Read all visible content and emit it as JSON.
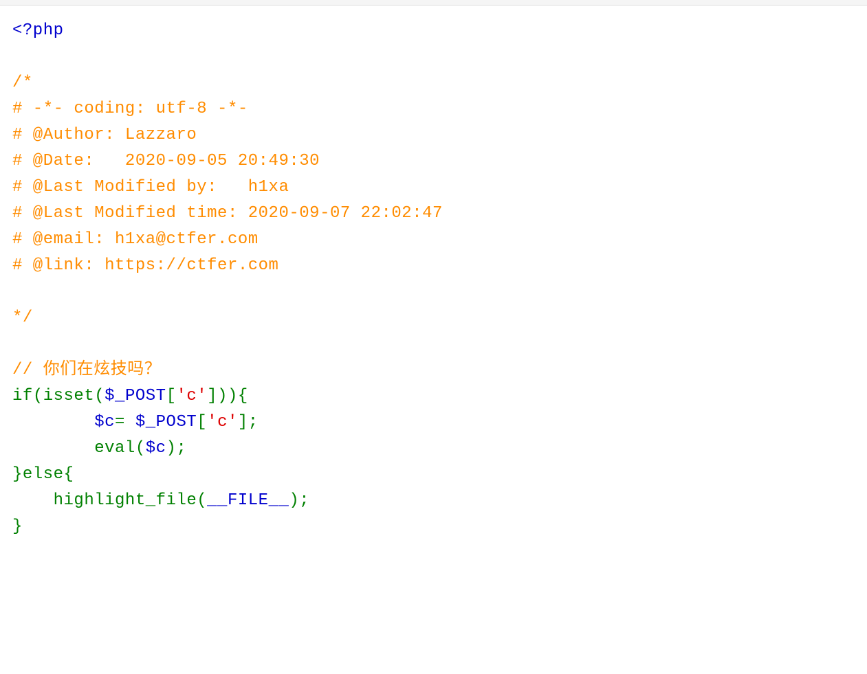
{
  "code": {
    "phpOpen": "<?php",
    "commentBlock": {
      "open": "/*",
      "line1_a": "# -*- coding: utf-8 -*-",
      "line2_a": "# @Author: Lazzaro",
      "line3_a": "# @Date:   2020-09-05 20:49:30",
      "line4_a": "# @Last Modified by:   h1xa",
      "line5_a": "# @Last Modified time: 2020-09-07 22:02:47",
      "line6_a": "# @email: h1xa@ctfer.com",
      "line7_a": "# @link: https://ctfer.com",
      "close": "*/"
    },
    "singleComment": "// 你们在炫技吗？",
    "ifKeyword": "if",
    "issetFn": "isset",
    "postVar1": "$_POST",
    "bracketOpen1": "[",
    "stringC1": "'c'",
    "bracketClose1": "]",
    "closeParens": "))",
    "openBrace1": "{",
    "cVar": "$c",
    "equals": "= ",
    "postVar2": "$_POST",
    "bracketOpen2": "[",
    "stringC2": "'c'",
    "bracketClose2": "]",
    "semicolon1": ";",
    "evalFn": "eval",
    "openParen2": "(",
    "cVar2": "$c",
    "closeParen2": ")",
    "semicolon2": ";",
    "closeBrace1": "}",
    "elseKeyword": "else",
    "openBrace2": "{",
    "highlightFn": "highlight_file",
    "openParen3": "(",
    "fileConst": "__FILE__",
    "closeParen3": ")",
    "semicolon3": ";",
    "closeBrace2": "}"
  }
}
